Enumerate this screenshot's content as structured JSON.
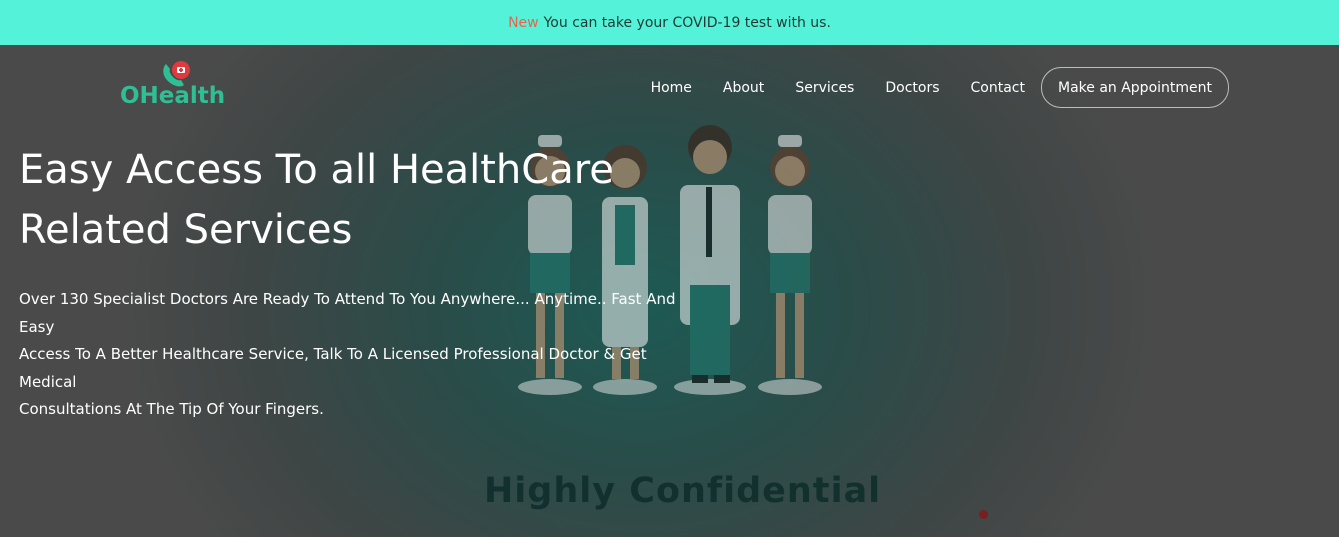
{
  "announcement": {
    "badge": "New",
    "text": "You can take your COVID-19 test with us."
  },
  "logo": {
    "text": "OHealth"
  },
  "nav": {
    "items": [
      "Home",
      "About",
      "Services",
      "Doctors",
      "Contact"
    ],
    "cta": "Make an Appointment"
  },
  "hero": {
    "headline_line1": "Easy Access To all HealthCare",
    "headline_line2": "Related Services",
    "description_line1": "Over 130 Specialist Doctors Are Ready To Attend To You Anywhere... Anytime.. Fast And Easy",
    "description_line2": "Access To A Better Healthcare Service, Talk To A Licensed Professional Doctor & Get Medical",
    "description_line3": "Consultations At The Tip Of Your Fingers.",
    "watermark": "Highly Confidential"
  },
  "colors": {
    "announcement_bg": "#54f2d9",
    "badge": "#e8634f",
    "brand": "#2fbf95"
  }
}
